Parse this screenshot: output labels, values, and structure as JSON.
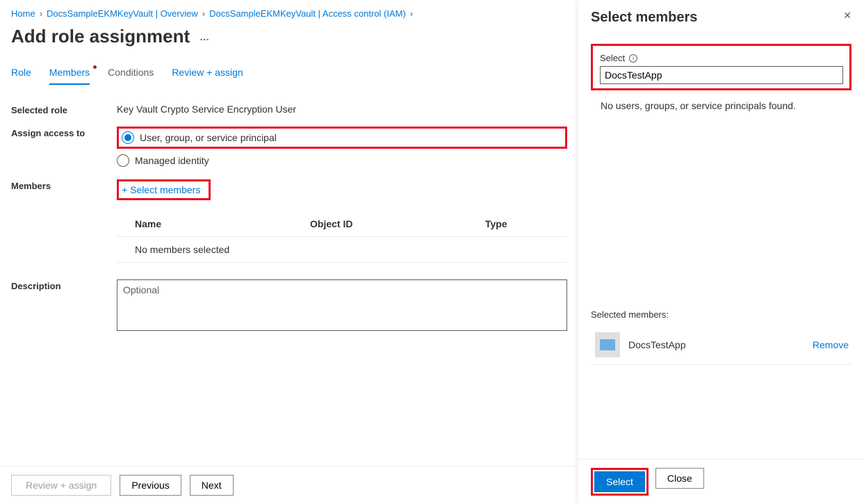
{
  "breadcrumb": {
    "home": "Home",
    "overview": "DocsSampleEKMKeyVault | Overview",
    "iam": "DocsSampleEKMKeyVault | Access control (IAM)"
  },
  "page_title": "Add role assignment",
  "tabs": {
    "role": "Role",
    "members": "Members",
    "conditions": "Conditions",
    "review": "Review + assign"
  },
  "form": {
    "selected_role_label": "Selected role",
    "selected_role_value": "Key Vault Crypto Service Encryption User",
    "assign_label": "Assign access to",
    "assign_option1": "User, group, or service principal",
    "assign_option2": "Managed identity",
    "members_label": "Members",
    "select_members_action": "Select members",
    "table": {
      "name": "Name",
      "objid": "Object ID",
      "type": "Type",
      "empty": "No members selected"
    },
    "description_label": "Description",
    "description_placeholder": "Optional"
  },
  "footer": {
    "review": "Review + assign",
    "previous": "Previous",
    "next": "Next"
  },
  "panel": {
    "title": "Select members",
    "select_label": "Select",
    "search_value": "DocsTestApp",
    "no_results": "No users, groups, or service principals found.",
    "selected_label": "Selected members:",
    "selected_member_name": "DocsTestApp",
    "remove": "Remove",
    "select_btn": "Select",
    "close_btn": "Close"
  }
}
